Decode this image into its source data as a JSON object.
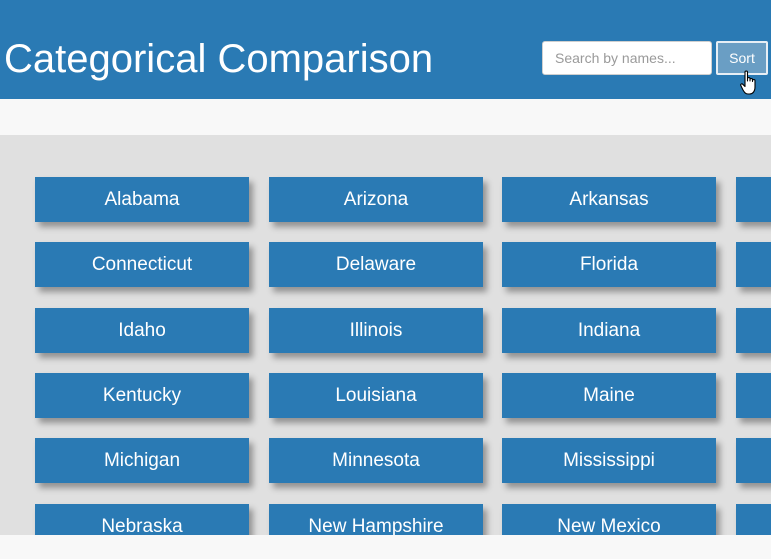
{
  "header": {
    "title": "Categorical Comparison",
    "search_placeholder": "Search by names...",
    "sort_label": "Sort"
  },
  "colors": {
    "header_bg": "#2a7ab4",
    "card_bg": "#2a7ab4",
    "grid_bg": "#e0e0e0"
  },
  "grid": {
    "columns": 4,
    "items": [
      "Alabama",
      "Arizona",
      "Arkansas",
      "",
      "Connecticut",
      "Delaware",
      "Florida",
      "",
      "Idaho",
      "Illinois",
      "Indiana",
      "",
      "Kentucky",
      "Louisiana",
      "Maine",
      "",
      "Michigan",
      "Minnesota",
      "Mississippi",
      "",
      "Nebraska",
      "New Hampshire",
      "New Mexico",
      ""
    ]
  }
}
